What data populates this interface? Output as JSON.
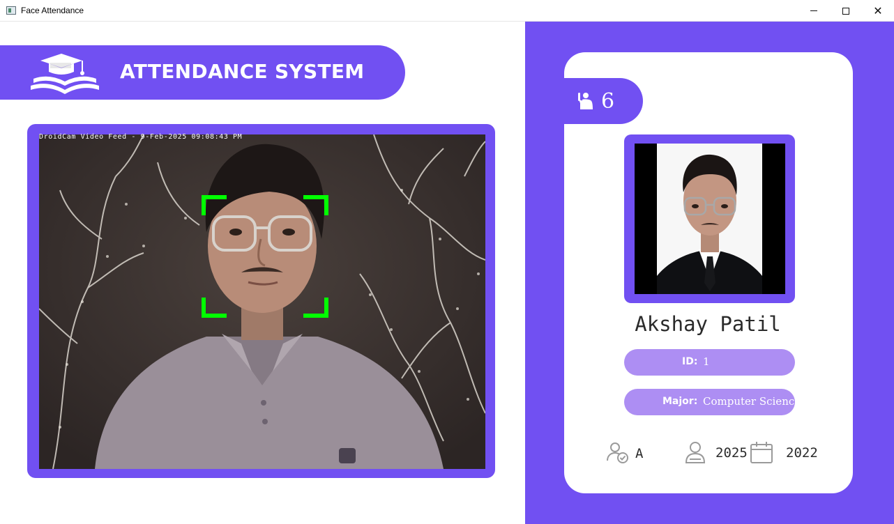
{
  "window": {
    "title": "Face Attendance",
    "minimize_icon": "minimize-icon",
    "maximize_icon": "maximize-icon",
    "close_icon": "close-icon",
    "close_glyph": "✕"
  },
  "header": {
    "title": "ATTENDANCE SYSTEM",
    "logo_icon": "graduation-book-icon",
    "accent_color": "#7150f2"
  },
  "camera": {
    "overlay_text": "DroidCam Video Feed - 9-Feb-2025 09:08:43 PM",
    "face_box_color": "#00ff00"
  },
  "student": {
    "count_icon": "raised-hand-user-icon",
    "total_attendance": "6",
    "name": "Akshay Patil",
    "id_label": "ID:",
    "id_value": "1",
    "major_label": "Major:",
    "major_value": "Computer Science",
    "standing_icon": "user-check-icon",
    "standing": "A",
    "year_icon": "user-icon",
    "year": "2025",
    "starting_year_icon": "calendar-icon",
    "starting_year": "2022",
    "pill_color": "#ad8ef3"
  }
}
